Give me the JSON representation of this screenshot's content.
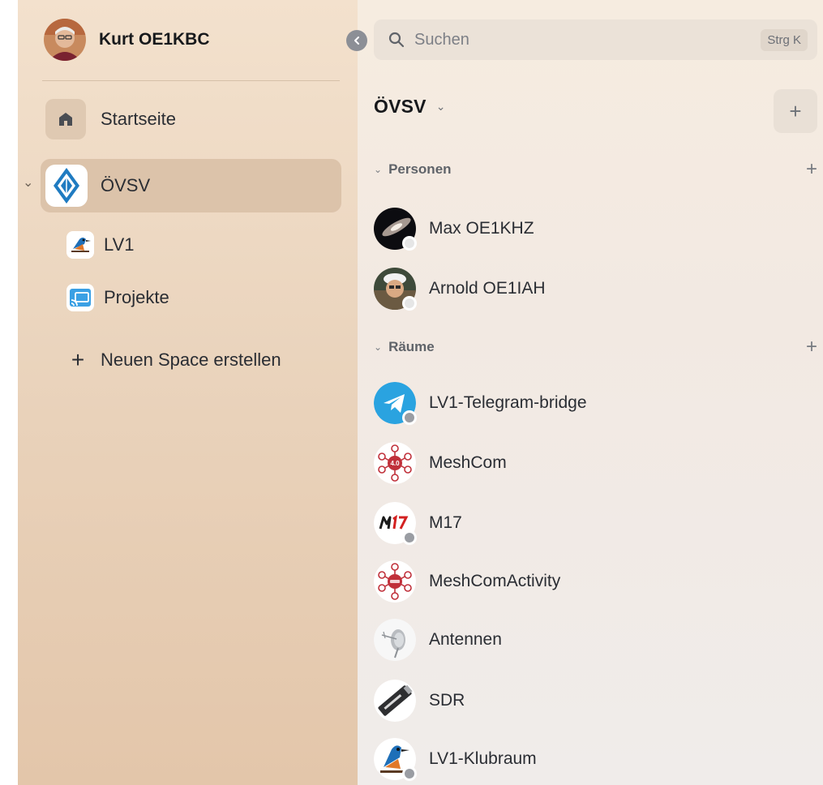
{
  "user": {
    "name": "Kurt OE1KBC",
    "avatar_icon": "user-avatar-icon"
  },
  "sidebar": {
    "home_label": "Startseite",
    "spaces": [
      {
        "label": "ÖVSV",
        "icon": "ovsv-diamond-logo-icon",
        "active": true
      },
      {
        "label": "LV1",
        "icon": "kingfisher-icon"
      },
      {
        "label": "Projekte",
        "icon": "cast-icon"
      }
    ],
    "create_label": "Neuen Space erstellen"
  },
  "search": {
    "placeholder": "Suchen",
    "shortcut": "Strg K"
  },
  "space": {
    "title": "ÖVSV",
    "add_symbol": "+"
  },
  "sections": {
    "people": {
      "label": "Personen",
      "add_symbol": "+"
    },
    "rooms": {
      "label": "Räume",
      "add_symbol": "+"
    }
  },
  "people": [
    {
      "name": "Max OE1KHZ",
      "icon": "galaxy-avatar-icon"
    },
    {
      "name": "Arnold OE1IAH",
      "icon": "user-photo-avatar-icon"
    }
  ],
  "rooms": [
    {
      "name": "LV1-Telegram-bridge",
      "icon": "telegram-icon"
    },
    {
      "name": "MeshCom",
      "icon": "meshcom-icon"
    },
    {
      "name": "M17",
      "icon": "m17-logo-icon"
    },
    {
      "name": "MeshComActivity",
      "icon": "meshcom-activity-icon"
    },
    {
      "name": "Antennen",
      "icon": "antenna-icon"
    },
    {
      "name": "SDR",
      "icon": "sdr-stick-icon"
    },
    {
      "name": "LV1-Klubraum",
      "icon": "kingfisher-icon"
    }
  ],
  "colors": {
    "sidebar_bg": "#ead4bd",
    "active_space_bg": "#dcc3aa",
    "panel_bg": "#f2e9e2",
    "telegram": "#2aa3e0",
    "mesh_red": "#c0303a"
  }
}
